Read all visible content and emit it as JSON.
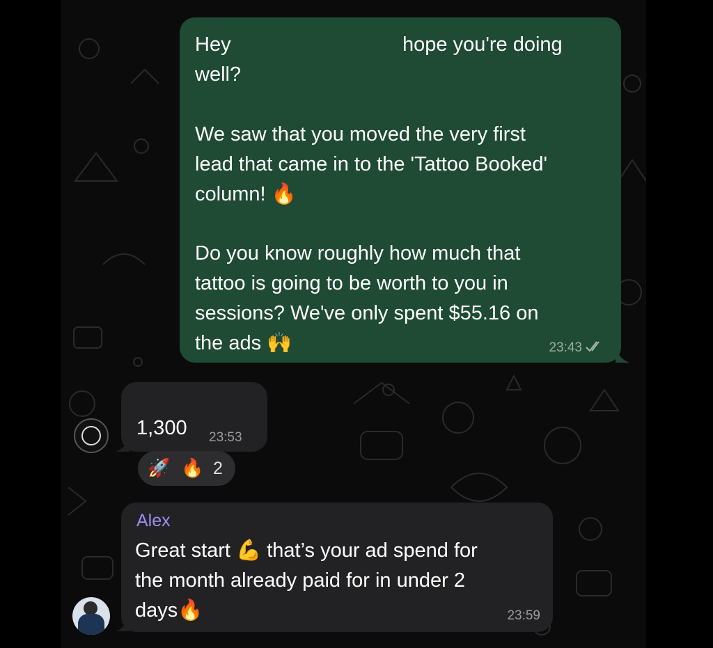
{
  "outgoing_message": {
    "lines": {
      "l1_left": "Hey",
      "l1_right": "hope you're doing",
      "l2": "well?",
      "l3": "We saw that you moved the very first",
      "l4": "lead that came in to the 'Tattoo Booked'",
      "l5": "column!",
      "l6": "Do you know roughly how much that",
      "l7": "tattoo is going to be worth to you in",
      "l8": "sessions? We've only spent $55.16 on",
      "l9": "the ads"
    },
    "emojis": {
      "fire": "🔥",
      "raised_hands": "🙌"
    },
    "time": "23:43",
    "status_icon": "double-check-icon"
  },
  "reply_message": {
    "text": "1,300",
    "time": "23:53",
    "reactions": {
      "rocket": "🚀",
      "fire": "🔥",
      "count": "2"
    }
  },
  "alex_message": {
    "sender": "Alex",
    "line1_a": "Great start",
    "line1_emoji": "💪",
    "line1_b": "that’s your ad spend for",
    "line2": "the month already paid for in under 2",
    "line3": "days",
    "line3_emoji": "🔥",
    "time": "23:59"
  },
  "colors": {
    "outgoing_bubble": "#1f4a33",
    "incoming_bubble": "#222224",
    "sender_name": "#9f8cf2",
    "background": "#0b0b0b"
  }
}
